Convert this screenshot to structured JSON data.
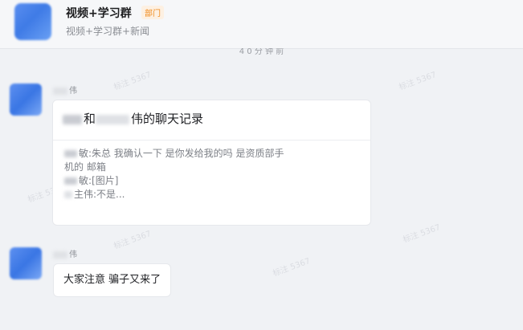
{
  "header": {
    "title": "视频+学习群",
    "badge": "部门",
    "subtitle": "视频+学习群+新闻"
  },
  "timestamp": "4 0 分 钟 前",
  "watermark": "标注 5367",
  "messages": [
    {
      "sender_suffix": "伟",
      "type": "chat_record",
      "record": {
        "title_prefix": "和",
        "title_suffix": "伟的聊天记录",
        "lines": [
          {
            "speaker_suffix": "敏:",
            "text": "朱总 我确认一下    是你发给我的吗   是资质部手"
          },
          {
            "speaker_suffix": "",
            "text": "机的 邮箱"
          },
          {
            "speaker_suffix": "敏:",
            "text": "[图片]"
          },
          {
            "speaker_suffix": "主伟:",
            "text": "不是..."
          }
        ]
      }
    },
    {
      "sender_suffix": "伟",
      "type": "text",
      "text": "大家注意 骗子又来了"
    }
  ]
}
